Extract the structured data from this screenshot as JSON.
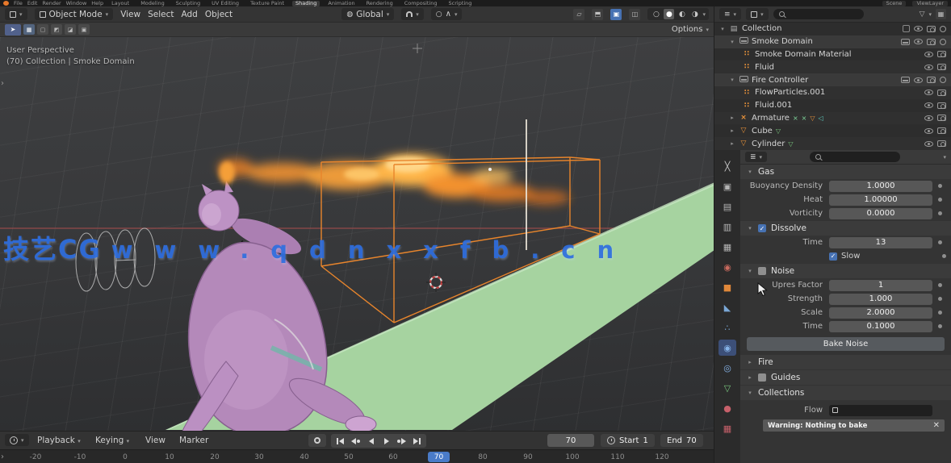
{
  "topbar": {
    "menus": [
      "File",
      "Edit",
      "Render",
      "Window",
      "Help"
    ],
    "workspaces": [
      "Layout",
      "Modeling",
      "Sculpting",
      "UV Editing",
      "Texture Paint",
      "Shading",
      "Animation",
      "Rendering",
      "Compositing",
      "Scripting"
    ],
    "active_workspace": "Shading",
    "scene": "Scene",
    "view_layer": "ViewLayer"
  },
  "viewport_header": {
    "mode": "Object Mode",
    "menu_view": "View",
    "menu_select": "Select",
    "menu_add": "Add",
    "menu_object": "Object",
    "orientation": "Global"
  },
  "tool_settings": {
    "options_label": "Options"
  },
  "viewport": {
    "overlay_line1": "User Perspective",
    "overlay_line2": "(70) Collection | Smoke Domain",
    "watermark_cjk": "技艺CG",
    "watermark_url": "www.qdnxxfb.cn"
  },
  "outliner": {
    "rows": [
      {
        "name": "Collection"
      },
      {
        "name": "Smoke Domain"
      },
      {
        "name": "Smoke Domain Material"
      },
      {
        "name": "Fluid"
      },
      {
        "name": "Fire Controller"
      },
      {
        "name": "FlowParticles.001"
      },
      {
        "name": "Fluid.001"
      },
      {
        "name": "Armature"
      },
      {
        "name": "Cube"
      },
      {
        "name": "Cylinder"
      }
    ]
  },
  "properties": {
    "tabs": [
      "tool",
      "render",
      "output",
      "view-layer",
      "scene",
      "world",
      "object",
      "modifiers",
      "particles",
      "physics",
      "constraints",
      "object-data",
      "material",
      "texture"
    ],
    "active_tab": "physics",
    "gas": {
      "title": "Gas",
      "fields": [
        {
          "label": "Buoyancy Density",
          "value": "1.0000"
        },
        {
          "label": "Heat",
          "value": "1.00000"
        },
        {
          "label": "Vorticity",
          "value": "0.0000"
        }
      ]
    },
    "dissolve": {
      "title": "Dissolve",
      "time_label": "Time",
      "time_value": "13",
      "slow_label": "Slow"
    },
    "noise": {
      "title": "Noise",
      "fields": [
        {
          "label": "Upres Factor",
          "value": "1"
        },
        {
          "label": "Strength",
          "value": "1.000"
        },
        {
          "label": "Scale",
          "value": "2.0000"
        },
        {
          "label": "Time",
          "value": "0.1000"
        }
      ],
      "bake_label": "Bake Noise"
    },
    "fire": {
      "title": "Fire"
    },
    "guides": {
      "title": "Guides"
    },
    "collections": {
      "title": "Collections",
      "flow_label": "Flow",
      "warning": "Warning: Nothing to bake"
    }
  },
  "timeline": {
    "menu_playback": "Playback",
    "menu_keying": "Keying",
    "menu_view": "View",
    "menu_marker": "Marker",
    "current_frame": "70",
    "start_label": "Start",
    "start_value": "1",
    "end_label": "End",
    "end_value": "70",
    "ruler": [
      "-20",
      "-10",
      "0",
      "10",
      "20",
      "30",
      "40",
      "50",
      "60",
      "80",
      "90",
      "100",
      "110",
      "120"
    ]
  },
  "colors": {
    "accent_blue": "#4772b3",
    "domain_orange": "#e8852c",
    "watermark_blue": "#2f6fe0",
    "strip_green": "#a6d3a0"
  }
}
